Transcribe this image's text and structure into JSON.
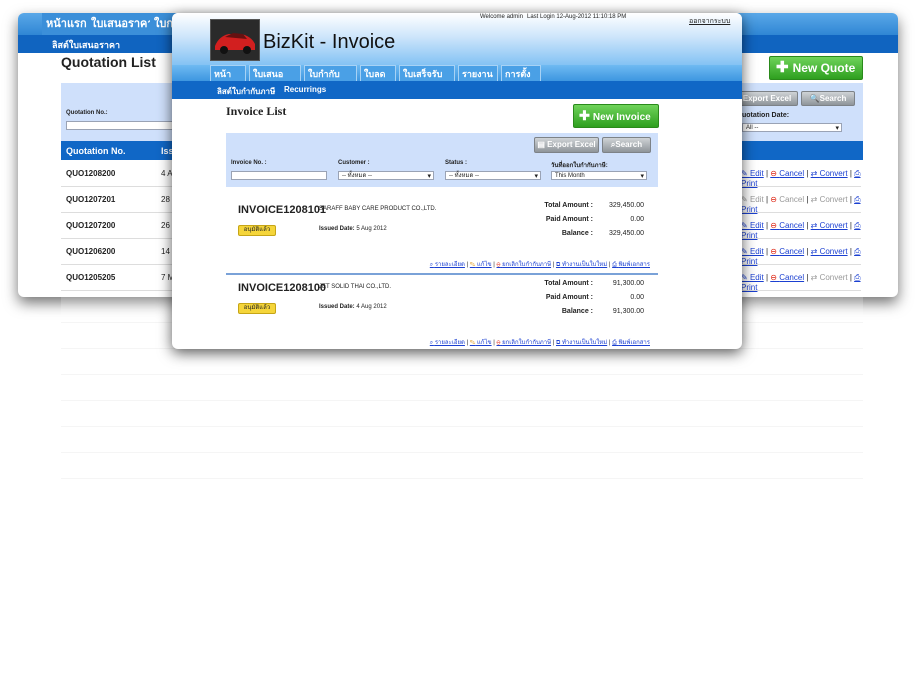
{
  "back_window": {
    "nav": [
      "หน้าแรก",
      "ใบเสนอราคา",
      "ใบก"
    ],
    "subnav": "ลิสต์ใบเสนอราคา",
    "title": "Quotation List",
    "new_button": "New Quote",
    "export_label": "Export Excel",
    "search_label": "Search",
    "quotation_no_label": "Quotation No.:",
    "quotation_date_label": "uotation Date:",
    "quotation_date_value": "All --",
    "col_quotation_no": "Quotation No.",
    "col_issued": "Iss",
    "rows": [
      {
        "no": "QUO1208200",
        "issued": "4 A",
        "edit_active": true,
        "cancel_active": true,
        "convert_active": true
      },
      {
        "no": "QUO1207201",
        "issued": "28",
        "edit_active": false,
        "cancel_active": false,
        "convert_active": false
      },
      {
        "no": "QUO1207200",
        "issued": "26",
        "edit_active": true,
        "cancel_active": true,
        "convert_active": true
      },
      {
        "no": "QUO1206200",
        "issued": "14 J",
        "edit_active": true,
        "cancel_active": true,
        "convert_active": true
      },
      {
        "no": "QUO1205205",
        "issued": "7 M",
        "edit_active": true,
        "cancel_active": true,
        "convert_active": false
      }
    ],
    "actions": {
      "edit": "Edit",
      "cancel": "Cancel",
      "convert": "Convert",
      "print": "Print"
    }
  },
  "front_window": {
    "app_title": "BizKit - Invoice",
    "welcome": "Welcome admin",
    "last_login": "Last Login 12-Aug-2012 11:10:18 PM",
    "logout": "ออกจากระบบ",
    "nav": [
      "หน้าแรก",
      "ใบเสนอราคา",
      "ใบกำกับภาษี",
      "ใบลดหนี้",
      "ใบเสร็จรับเงิน",
      "รายงาน",
      "การตั้งค่า"
    ],
    "subnav": [
      "ลิสต์ใบกำกับภาษี",
      "Recurrings"
    ],
    "page_title": "Invoice List",
    "new_button": "New Invoice",
    "export_label": "Export Excel",
    "search_label": "Search",
    "filters": {
      "invoice_no_label": "Invoice No. :",
      "customer_label": "Customer :",
      "customer_value": "-- ทั้งหมด --",
      "status_label": "Status :",
      "status_value": "-- ทั้งหมด --",
      "date_label": "วันที่ออกใบกำกับภาษี:",
      "date_value": "This Month"
    },
    "amount_labels": {
      "total": "Total Amount :",
      "paid": "Paid Amount :",
      "balance": "Balance :"
    },
    "issued_prefix": "Issued Date:",
    "actions": [
      "รายละเอียด",
      "แก้ไข",
      "ยกเลิกใบกำกับภาษี",
      "ทำงานเป็นใบใหม่",
      "พิมพ์เอกสาร"
    ],
    "invoices": [
      {
        "no": "INVOICE1208101",
        "customer": "SARAFF BABY CARE PRODUCT CO.,LTD.",
        "status": "อนุมัติแล้ว",
        "issued": "5 Aug 2012",
        "total": "329,450.00",
        "paid": "0.00",
        "balance": "329,450.00"
      },
      {
        "no": "INVOICE1208100",
        "customer": "JET SOLID THAI CO.,LTD.",
        "status": "อนุมัติแล้ว",
        "issued": "4 Aug 2012",
        "total": "91,300.00",
        "paid": "0.00",
        "balance": "91,300.00"
      }
    ]
  }
}
